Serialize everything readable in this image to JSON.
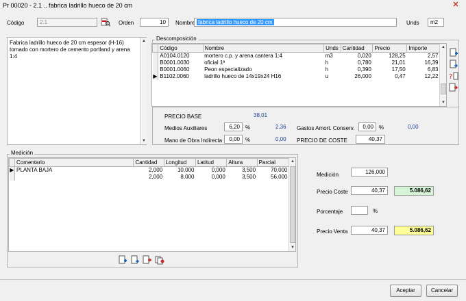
{
  "window": {
    "title": "Pr 00020 - 2.1 .. fabrica ladrillo hueco de 20 cm",
    "close_glyph": "✕"
  },
  "header": {
    "codigo_label": "Código",
    "codigo_value": "2.1",
    "orden_label": "Orden",
    "orden_value": "10",
    "nombre_label": "Nombre",
    "nombre_value": "fabrica ladrillo hueco de 20 cm",
    "unds_label": "Unds",
    "unds_value": "m2"
  },
  "description": "Fabrica ladrillo hueco de 20 cm espesor (H-16) tomado con mortero de cemento portland y arena 1:4",
  "descomposicion": {
    "title": "Descomposición",
    "columns": [
      "Código",
      "Nombre",
      "Unds",
      "Cantidad",
      "Precio",
      "Importe"
    ],
    "rows": [
      [
        "A0104.0120",
        "mortero c.p. y arena cantera 1:4",
        "m3",
        "0,020",
        "128,25",
        "2,57"
      ],
      [
        "B0001.0030",
        "oficial 1ª",
        "h",
        "0,780",
        "21,01",
        "16,39"
      ],
      [
        "B0001.0060",
        "Peon especializado",
        "h",
        "0,390",
        "17,50",
        "6,83"
      ],
      [
        "B1102.0060",
        "ladrillo hueco de 14x19x24 H16",
        "u",
        "26,000",
        "0,47",
        "12,22"
      ]
    ],
    "current_row": 3
  },
  "costs": {
    "precio_base_label": "PRECIO BASE",
    "precio_base_value": "38,01",
    "medios_label": "Medios Auxiliares",
    "medios_pct": "6,20",
    "medios_value": "2,36",
    "mano_label": "Mano de Obra Indirecta",
    "mano_pct": "0,00",
    "mano_value": "0,00",
    "gastos_label": "Gastos Amort. Conserv.",
    "gastos_pct": "0,00",
    "gastos_value": "0,00",
    "precio_coste_label": "PRECIO DE COSTE",
    "precio_coste_value": "40,37",
    "pct_sign": "%"
  },
  "medicion": {
    "title": "Medición",
    "columns": [
      "Comentario",
      "Cantidad",
      "Longitud",
      "Latitud",
      "Altura",
      "Parcial"
    ],
    "rows": [
      [
        "PLANTA BAJA",
        "2,000",
        "10,000",
        "0,000",
        "3,500",
        "70,000"
      ],
      [
        "",
        "2,000",
        "8,000",
        "0,000",
        "3,500",
        "56,000"
      ]
    ],
    "current_row": 0
  },
  "summary": {
    "medicion_label": "Medición",
    "medicion_value": "126,000",
    "precio_coste_label": "Precio Coste",
    "precio_coste_value": "40,37",
    "precio_coste_total": "5.086,62",
    "porcentaje_label": "Porcentaje",
    "porcentaje_value": "",
    "pct_sign": "%",
    "precio_venta_label": "Precio Venta",
    "precio_venta_value": "40,37",
    "precio_venta_total": "5.086,62"
  },
  "buttons": {
    "accept": "Aceptar",
    "cancel": "Cancelar"
  },
  "colors": {
    "accent_selection": "#3399ff",
    "total_green": "#d6f5d6",
    "total_yellow": "#ffff99",
    "value_blue": "#1a3f8f"
  },
  "icons": [
    "search-record-icon",
    "insert-row-icon",
    "edit-row-icon",
    "help-row-icon",
    "delete-row-icon"
  ]
}
